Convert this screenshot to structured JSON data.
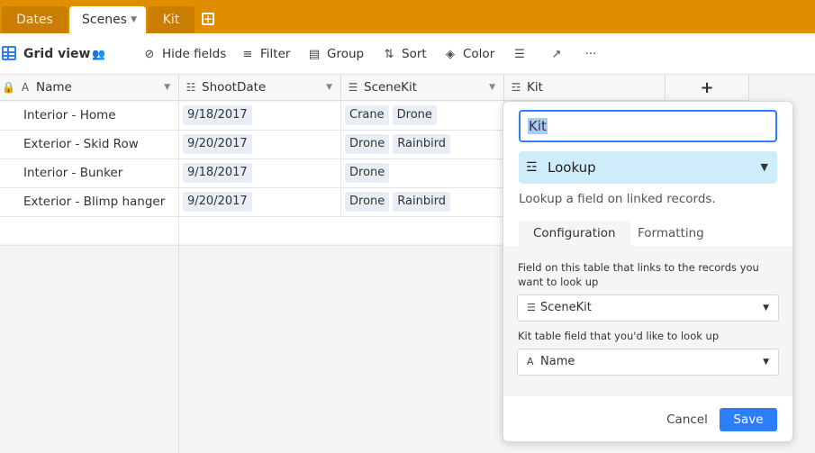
{
  "tabs": [
    {
      "label": "Dates"
    },
    {
      "label": "Scenes",
      "active": true
    },
    {
      "label": "Kit"
    }
  ],
  "toolbar": {
    "view_name": "Grid view",
    "hide_fields": "Hide fields",
    "filter": "Filter",
    "group": "Group",
    "sort": "Sort",
    "color": "Color",
    "more": "···"
  },
  "columns": [
    {
      "label": "Name",
      "icon": "text-icon"
    },
    {
      "label": "ShootDate",
      "icon": "date-icon"
    },
    {
      "label": "SceneKit",
      "icon": "link-icon"
    },
    {
      "label": "Kit",
      "icon": "lookup-icon"
    },
    {
      "label": "+"
    }
  ],
  "rows": [
    {
      "name": "Interior - Home",
      "date": "9/18/2017",
      "kit": [
        "Crane",
        "Drone"
      ]
    },
    {
      "name": "Exterior - Skid Row",
      "date": "9/20/2017",
      "kit": [
        "Drone",
        "Rainbird"
      ]
    },
    {
      "name": "Interior - Bunker",
      "date": "9/18/2017",
      "kit": [
        "Drone"
      ]
    },
    {
      "name": "Exterior - Blimp hanger",
      "date": "9/20/2017",
      "kit": [
        "Drone",
        "Rainbird"
      ]
    }
  ],
  "popover": {
    "field_name": "Kit",
    "field_type": "Lookup",
    "type_description": "Lookup a field on linked records.",
    "tabs": [
      "Configuration",
      "Formatting"
    ],
    "link_field_label": "Field on this table that links to the records you want to look up",
    "link_field_value": "SceneKit",
    "lookup_field_label": "Kit table field that you'd like to look up",
    "lookup_field_value": "Name",
    "cancel": "Cancel",
    "save": "Save"
  },
  "colors": {
    "tabbar": "#e08d00",
    "accent": "#2d7ff9",
    "type_bg": "#cfecfb",
    "chip_bg": "#e9eef6"
  }
}
